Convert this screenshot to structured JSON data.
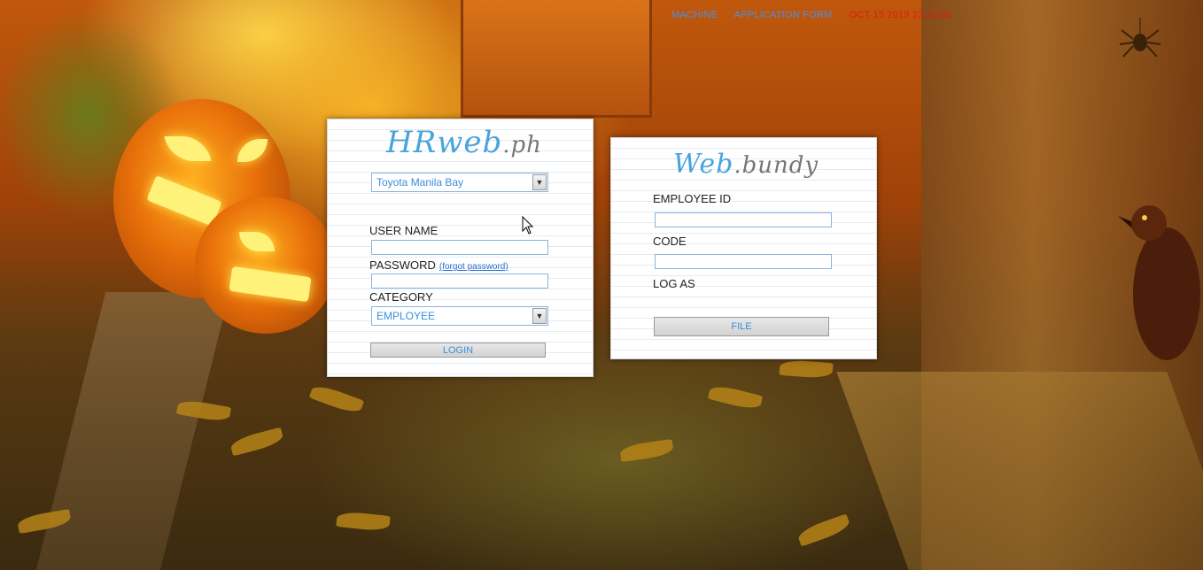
{
  "nav": {
    "machine": "MACHINE",
    "application_form": "APPLICATION FORM",
    "datetime": "OCT 15 2019 23:33:00"
  },
  "hrweb": {
    "logo_main": "HRweb",
    "logo_suffix": ".ph",
    "company_select": "Toyota Manila Bay",
    "username_label": "USER NAME",
    "username_value": "",
    "password_label": "PASSWORD",
    "forgot_label": "(forgot password)",
    "password_value": "",
    "category_label": "CATEGORY",
    "category_select": "EMPLOYEE",
    "login_label": "LOGIN"
  },
  "bundy": {
    "logo_main": "Web",
    "logo_suffix": ".bundy",
    "employee_id_label": "EMPLOYEE ID",
    "employee_id_value": "",
    "code_label": "CODE",
    "code_value": "",
    "log_as_label": "LOG AS",
    "file_label": "FILE"
  },
  "colors": {
    "link": "#4a8fe0",
    "datetime": "#e01818",
    "accent": "#4aa4dc"
  },
  "icons": {
    "dropdown": "chevron-down-icon",
    "spider": "spider-icon",
    "crow": "crow-icon"
  }
}
